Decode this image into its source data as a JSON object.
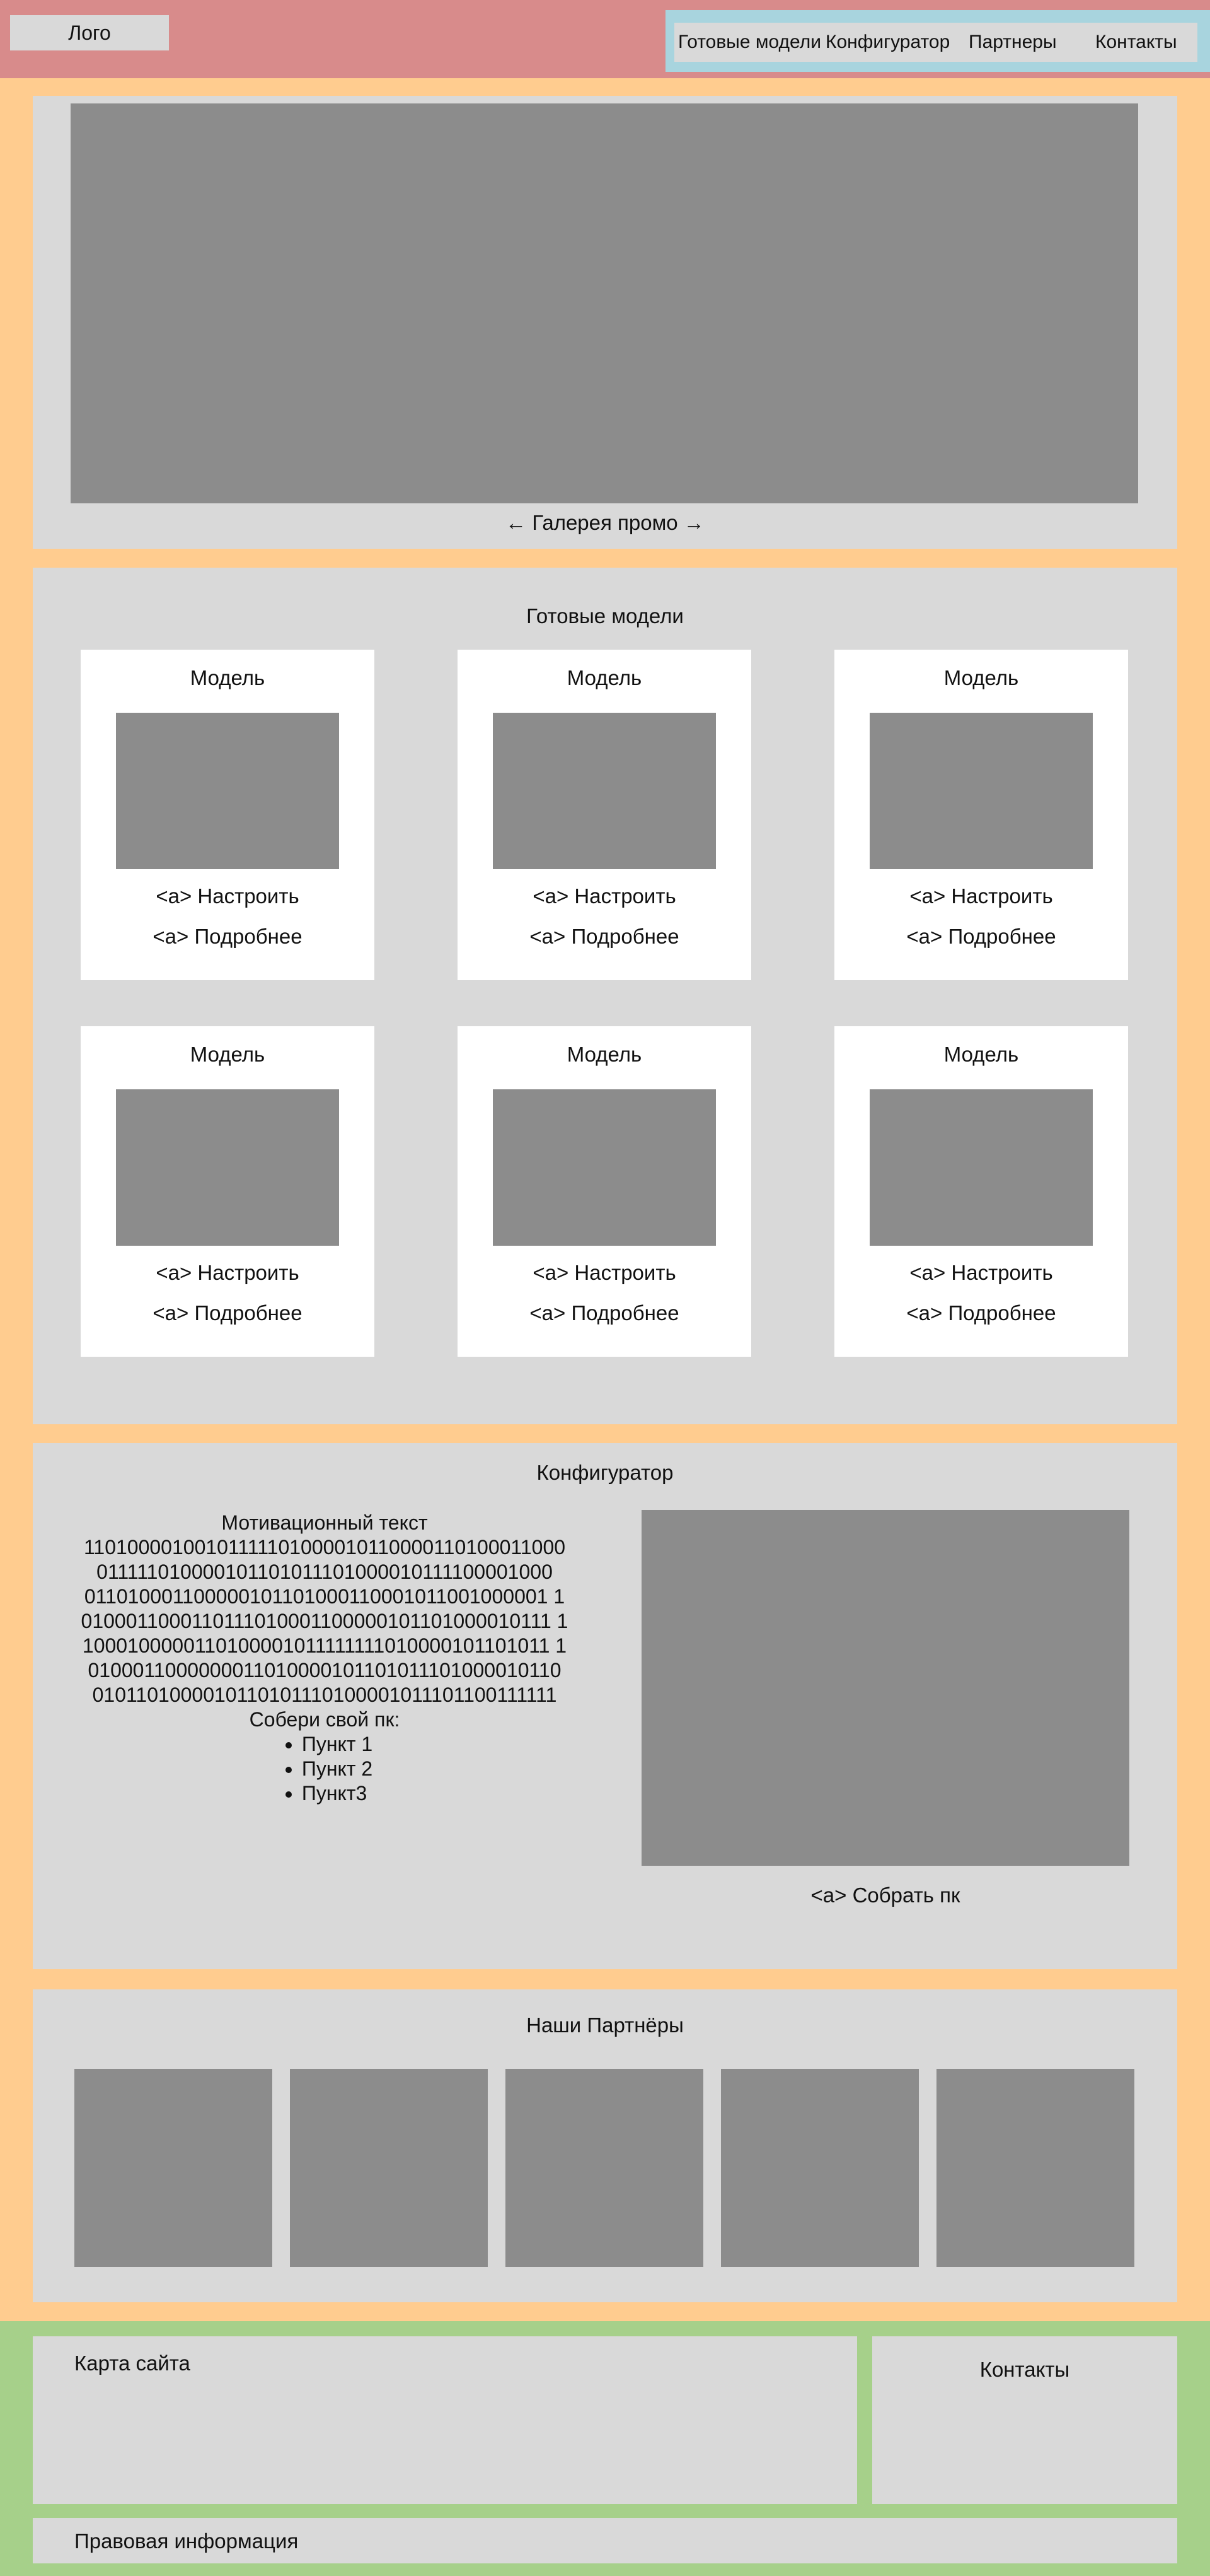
{
  "header": {
    "logo": "Лого",
    "nav": [
      "Готовые модели",
      "Конфигуратор",
      "Партнеры",
      "Контакты"
    ]
  },
  "promo": {
    "caption": "← Галерея промо →"
  },
  "models": {
    "title": "Готовые модели",
    "cards": [
      {
        "title": "Модель",
        "link1": "<a> Настроить",
        "link2": "<a> Подробнее"
      },
      {
        "title": "Модель",
        "link1": "<a> Настроить",
        "link2": "<a> Подробнее"
      },
      {
        "title": "Модель",
        "link1": "<a> Настроить",
        "link2": "<a> Подробнее"
      },
      {
        "title": "Модель",
        "link1": "<a> Настроить",
        "link2": "<a> Подробнее"
      },
      {
        "title": "Модель",
        "link1": "<a> Настроить",
        "link2": "<a> Подробнее"
      },
      {
        "title": "Модель",
        "link1": "<a> Настроить",
        "link2": "<a> Подробнее"
      }
    ]
  },
  "configurator": {
    "title": "Конфигуратор",
    "motivation_heading": "Мотивационный текст",
    "binary_lines": [
      "11010000100101111101000010110000110100011000",
      "011111010000101101011101000010111100001000",
      "011010001100000101101000110001011001000001 1",
      "0100011000110111010001100000101101000010111 1",
      "1000100000110100001011111111010000101101011 1",
      "0100011000000011010000101101011101000010110",
      "0101101000010110101110100001011101100111111"
    ],
    "build_label": "Собери свой пк:",
    "bullets": [
      "Пункт 1",
      "Пункт 2",
      "Пункт3"
    ],
    "build_link": "<a> Собрать пк"
  },
  "partners": {
    "title": "Наши Партнёры"
  },
  "footer": {
    "sitemap": "Карта сайта",
    "contacts": "Контакты",
    "legal": "Правовая информация"
  },
  "colors": {
    "header_bg": "#d88b8b",
    "nav_outer_bg": "#a8d4de",
    "page_bg": "#ffcc8f",
    "section_bg": "#d9d9d9",
    "placeholder_bg": "#8c8c8c",
    "card_bg": "#ffffff",
    "footer_bg": "#a6d08a"
  }
}
